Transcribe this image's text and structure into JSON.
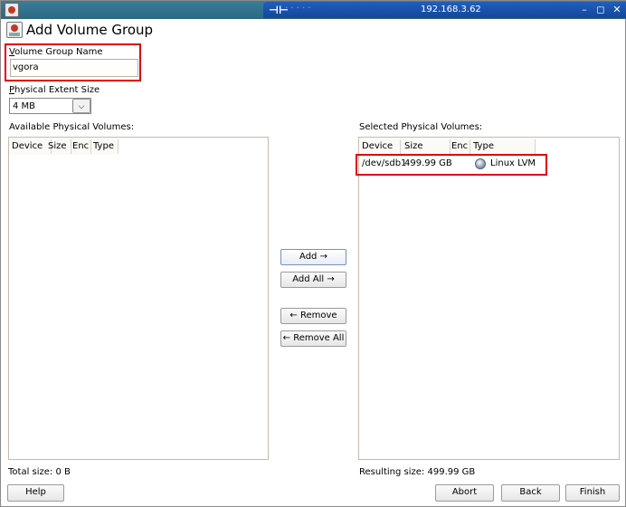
{
  "window": {
    "remote_title": "192.168.3.62",
    "remote_dots": "· · ·  · ·",
    "min_glyph": "–",
    "max_glyph": "◻",
    "close_glyph": "✕"
  },
  "header": {
    "title": "Add Volume Group"
  },
  "vg_name": {
    "label_u": "V",
    "label_rest": "olume Group Name",
    "value": "vgora"
  },
  "extent": {
    "label_u": "P",
    "label_rest": "hysical Extent Size",
    "value": "4 MB"
  },
  "available": {
    "label": "Available Physical Volumes:",
    "columns": [
      "Device",
      "Size",
      "Enc",
      "Type"
    ],
    "rows": [],
    "total_label": "Total size: 0 B"
  },
  "selected": {
    "label": "Selected Physical Volumes:",
    "columns": [
      "Device",
      "Size",
      "Enc",
      "Type"
    ],
    "rows": [
      {
        "device": "/dev/sdb1",
        "size": "499.99 GB",
        "enc": "",
        "type": "Linux LVM"
      }
    ],
    "total_label": "Resulting size: 499.99 GB"
  },
  "mid_buttons": {
    "add": "Add →",
    "add_all": "Add All →",
    "remove": "← Remove",
    "remove_all": "← Remove All"
  },
  "footer": {
    "help": "Help",
    "abort": "Abort",
    "back": "Back",
    "finish": "Finish"
  },
  "colors": {
    "highlight": "#e0000f",
    "titlebar": "#2b6883",
    "remote_bar": "#1f5fbd"
  }
}
